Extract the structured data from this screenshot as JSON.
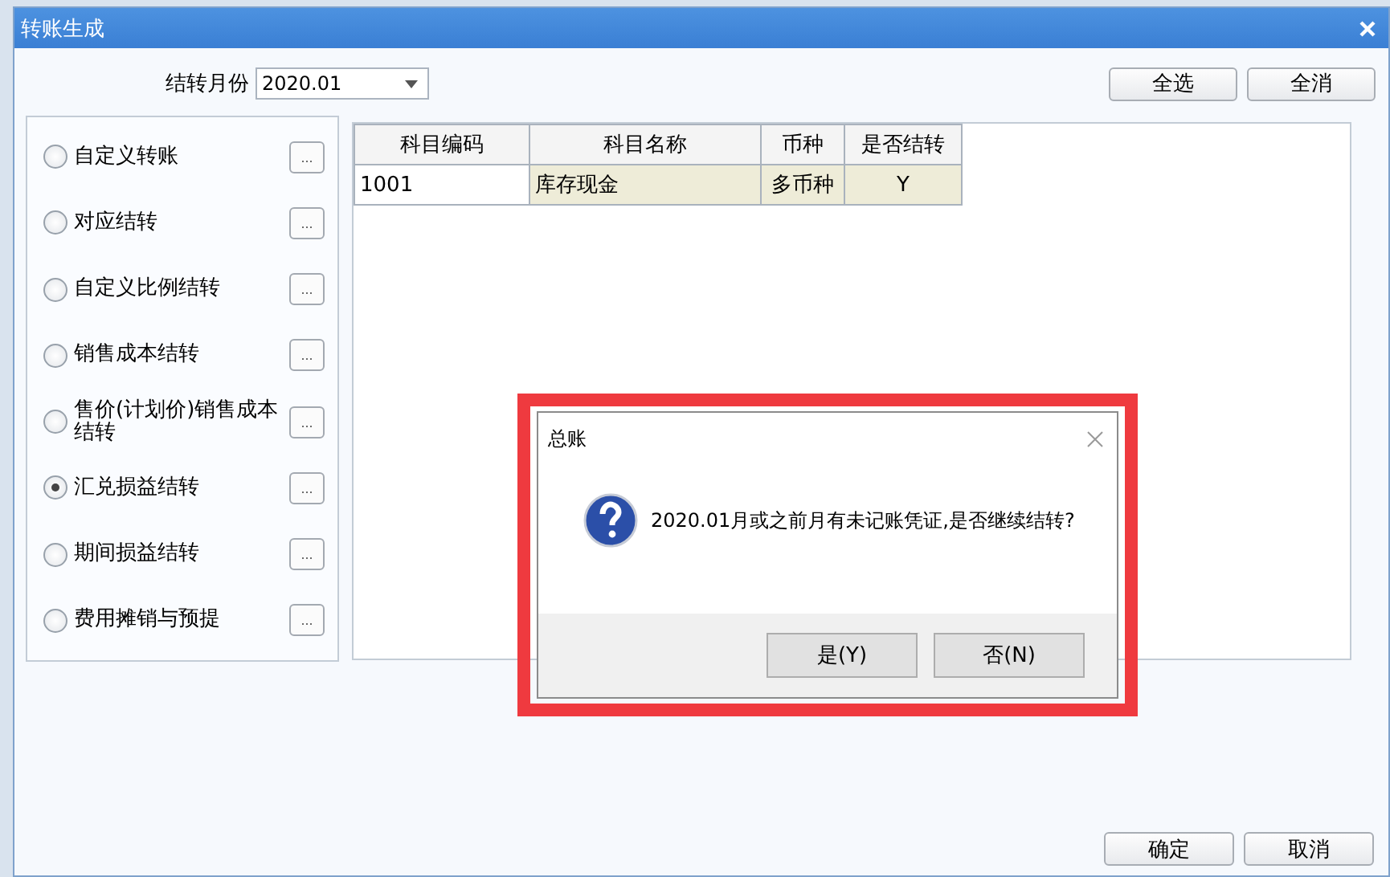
{
  "window": {
    "title": "转账生成"
  },
  "period": {
    "label": "结转月份",
    "value": "2020.01"
  },
  "top_buttons": [
    "全选",
    "全消"
  ],
  "transfer_types": [
    {
      "label": "自定义转账",
      "selected": false
    },
    {
      "label": "对应结转",
      "selected": false
    },
    {
      "label": "自定义比例结转",
      "selected": false
    },
    {
      "label": "销售成本结转",
      "selected": false
    },
    {
      "label": "售价(计划价)销售成本结转",
      "selected": false
    },
    {
      "label": "汇兑损益结转",
      "selected": true
    },
    {
      "label": "期间损益结转",
      "selected": false
    },
    {
      "label": "费用摊销与预提",
      "selected": false
    }
  ],
  "more_button": "...",
  "table": {
    "columns": [
      "科目编码",
      "科目名称",
      "币种",
      "是否结转"
    ],
    "rows": [
      [
        "1001",
        "库存现金",
        "多币种",
        "Y"
      ]
    ]
  },
  "dialog": {
    "title": "总账",
    "message": "2020.01月或之前月有未记账凭证,是否继续结转?",
    "buttons": [
      "是(Y)",
      "否(N)"
    ],
    "highlighted": true
  },
  "footer_buttons": [
    "确定",
    "取消"
  ]
}
